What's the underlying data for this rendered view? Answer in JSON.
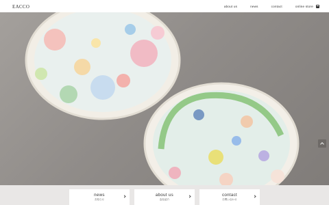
{
  "header": {
    "logo_text": "EACCO",
    "nav": [
      {
        "label": "about us"
      },
      {
        "label": "news"
      },
      {
        "label": "contact"
      },
      {
        "label": "online store"
      }
    ]
  },
  "cards": [
    {
      "title": "news",
      "subtitle": "お知らせ"
    },
    {
      "title": "about us",
      "subtitle": "会社紹介"
    },
    {
      "title": "contact",
      "subtitle": "お問い合わせ"
    }
  ],
  "colors": {
    "header_bg": "#ffffff",
    "bottom_bg": "#e9e7e6",
    "text": "#333333"
  },
  "icons": [
    "online-store-icon",
    "page-top-icon",
    "chevron-right-icon"
  ]
}
